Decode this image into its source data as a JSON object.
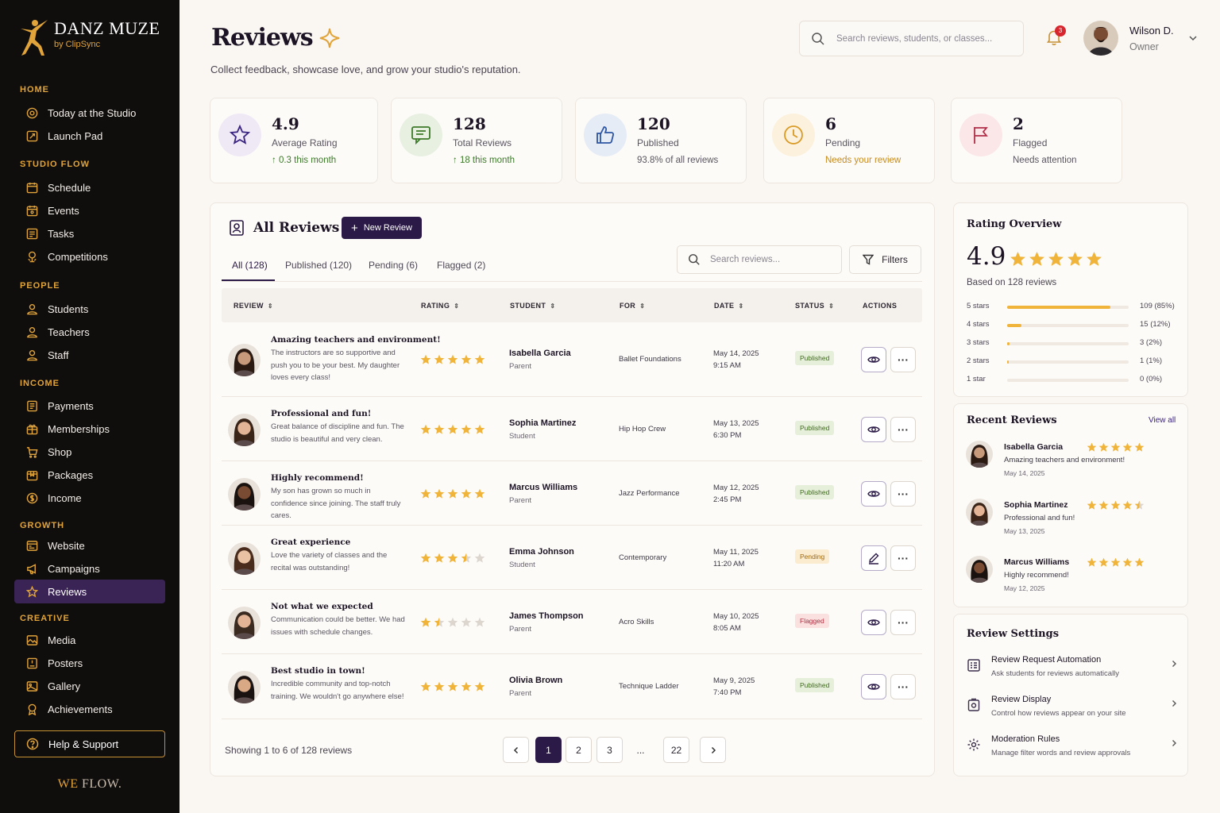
{
  "brand": {
    "name": "DANZ MUZE",
    "by": "by ClipSync",
    "footer_a": "WE",
    "footer_b": "FLOW."
  },
  "sidebar": {
    "sections": [
      "HOME",
      "STUDIO FLOW",
      "PEOPLE",
      "INCOME",
      "GROWTH",
      "CREATIVE"
    ],
    "items": [
      "Today at the Studio",
      "Launch Pad",
      "Schedule",
      "Events",
      "Tasks",
      "Competitions",
      "Students",
      "Teachers",
      "Staff",
      "Payments",
      "Memberships",
      "Shop",
      "Packages",
      "Income",
      "Website",
      "Campaigns",
      "Reviews",
      "Media",
      "Posters",
      "Gallery",
      "Achievements"
    ],
    "help": "Help & Support",
    "active": "Reviews"
  },
  "header": {
    "title": "Reviews",
    "subtitle": "Collect feedback, showcase love, and grow your studio's reputation.",
    "search_placeholder": "Search reviews, students, or classes...",
    "notifications": "3",
    "user_name": "Wilson D.",
    "user_role": "Owner"
  },
  "stats": [
    {
      "value": "4.9",
      "label": "Average Rating",
      "sub": "↑ 0.3 this month"
    },
    {
      "value": "128",
      "label": "Total Reviews",
      "sub": "↑ 18 this month"
    },
    {
      "value": "120",
      "label": "Published",
      "sub": "93.8% of all reviews"
    },
    {
      "value": "6",
      "label": "Pending",
      "sub": "Needs your review"
    },
    {
      "value": "2",
      "label": "Flagged",
      "sub": "Needs attention"
    }
  ],
  "reviews": {
    "title": "All Reviews",
    "new_button": "New Review",
    "tabs": [
      "All (128)",
      "Published (120)",
      "Pending (6)",
      "Flagged (2)"
    ],
    "search_placeholder": "Search reviews...",
    "filters": "Filters",
    "columns": [
      "REVIEW",
      "RATING",
      "STUDENT",
      "FOR",
      "DATE",
      "STATUS",
      "ACTIONS"
    ],
    "rows": [
      {
        "title": "Amazing teachers and environment!",
        "body": "The instructors are so supportive and push you to be your best. My daughter loves every class!",
        "rating": 5,
        "student": "Isabella Garcia",
        "role": "Parent",
        "for": "Ballet Foundations",
        "date": "May 14, 2025",
        "time": "9:15 AM",
        "status": "Published"
      },
      {
        "title": "Professional and fun!",
        "body": "Great balance of discipline and fun. The studio is beautiful and very clean.",
        "rating": 5,
        "student": "Sophia Martinez",
        "role": "Student",
        "for": "Hip Hop Crew",
        "date": "May 13, 2025",
        "time": "6:30 PM",
        "status": "Published"
      },
      {
        "title": "Highly recommend!",
        "body": "My son has grown so much in confidence since joining. The staff truly cares.",
        "rating": 5,
        "student": "Marcus Williams",
        "role": "Parent",
        "for": "Jazz Performance",
        "date": "May 12, 2025",
        "time": "2:45 PM",
        "status": "Published"
      },
      {
        "title": "Great experience",
        "body": "Love the variety of classes and the recital was outstanding!",
        "rating": 3.5,
        "student": "Emma Johnson",
        "role": "Student",
        "for": "Contemporary",
        "date": "May 11, 2025",
        "time": "11:20 AM",
        "status": "Pending"
      },
      {
        "title": "Not what we expected",
        "body": "Communication could be better. We had issues with schedule changes.",
        "rating": 1.5,
        "student": "James Thompson",
        "role": "Parent",
        "for": "Acro Skills",
        "date": "May 10, 2025",
        "time": "8:05 AM",
        "status": "Flagged"
      },
      {
        "title": "Best studio in town!",
        "body": "Incredible community and top-notch training. We wouldn't go anywhere else!",
        "rating": 5,
        "student": "Olivia Brown",
        "role": "Parent",
        "for": "Technique Ladder",
        "date": "May 9, 2025",
        "time": "7:40 PM",
        "status": "Published"
      }
    ],
    "showing": "Showing 1 to 6 of 128 reviews",
    "pages": [
      "1",
      "2",
      "3",
      "...",
      "22"
    ]
  },
  "overview": {
    "title": "Rating Overview",
    "value": "4.9",
    "based": "Based on 128 reviews",
    "bars": [
      {
        "label": "5 stars",
        "pct": 85,
        "count": "109 (85%)"
      },
      {
        "label": "4 stars",
        "pct": 12,
        "count": "15 (12%)"
      },
      {
        "label": "3 stars",
        "pct": 2,
        "count": "3 (2%)"
      },
      {
        "label": "2 stars",
        "pct": 1,
        "count": "1 (1%)"
      },
      {
        "label": "1 star",
        "pct": 0,
        "count": "0 (0%)"
      }
    ]
  },
  "recent": {
    "title": "Recent Reviews",
    "view_all": "View all",
    "items": [
      {
        "name": "Isabella Garcia",
        "text": "Amazing teachers and environment!",
        "date": "May 14, 2025",
        "rating": 5
      },
      {
        "name": "Sophia Martinez",
        "text": "Professional and fun!",
        "date": "May 13, 2025",
        "rating": 4.5
      },
      {
        "name": "Marcus Williams",
        "text": "Highly recommend!",
        "date": "May 12, 2025",
        "rating": 5
      }
    ]
  },
  "settings": {
    "title": "Review Settings",
    "items": [
      {
        "title": "Review Request Automation",
        "desc": "Ask students for reviews automatically"
      },
      {
        "title": "Review Display",
        "desc": "Control how reviews appear on your site"
      },
      {
        "title": "Moderation Rules",
        "desc": "Manage filter words and review approvals"
      }
    ]
  },
  "colors": {
    "accent": "#2b1a47",
    "gold": "#e0a43a",
    "star": "#f0b43a",
    "sidebar": "#100d0d"
  }
}
